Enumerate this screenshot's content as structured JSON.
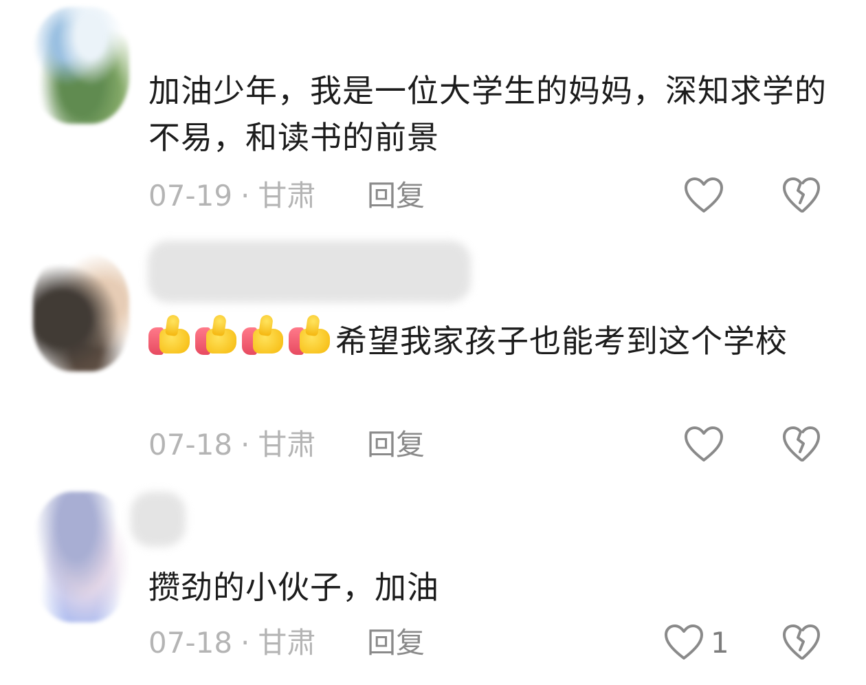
{
  "comments": [
    {
      "text": "加油少年，我是一位大学生的妈妈，深知求学的不易，和读书的前景",
      "date": "07-19",
      "location": "甘肃",
      "reply_label": "回复",
      "like_count": ""
    },
    {
      "emoji": [
        "thumbs-up-icon",
        "thumbs-up-icon",
        "thumbs-up-icon",
        "thumbs-up-icon"
      ],
      "text": "希望我家孩子也能考到这个学校",
      "date": "07-18",
      "location": "甘肃",
      "reply_label": "回复",
      "like_count": ""
    },
    {
      "text": "攒劲的小伙子，加油",
      "date": "07-18",
      "location": "甘肃",
      "reply_label": "回复",
      "like_count": "1"
    }
  ],
  "separator": "·",
  "colors": {
    "text": "#1c1c1c",
    "meta": "#b4b4b4",
    "icon": "#8a8a8a",
    "thumb_yellow": "#f6b80a",
    "thumb_cuff": "#e74a60"
  }
}
